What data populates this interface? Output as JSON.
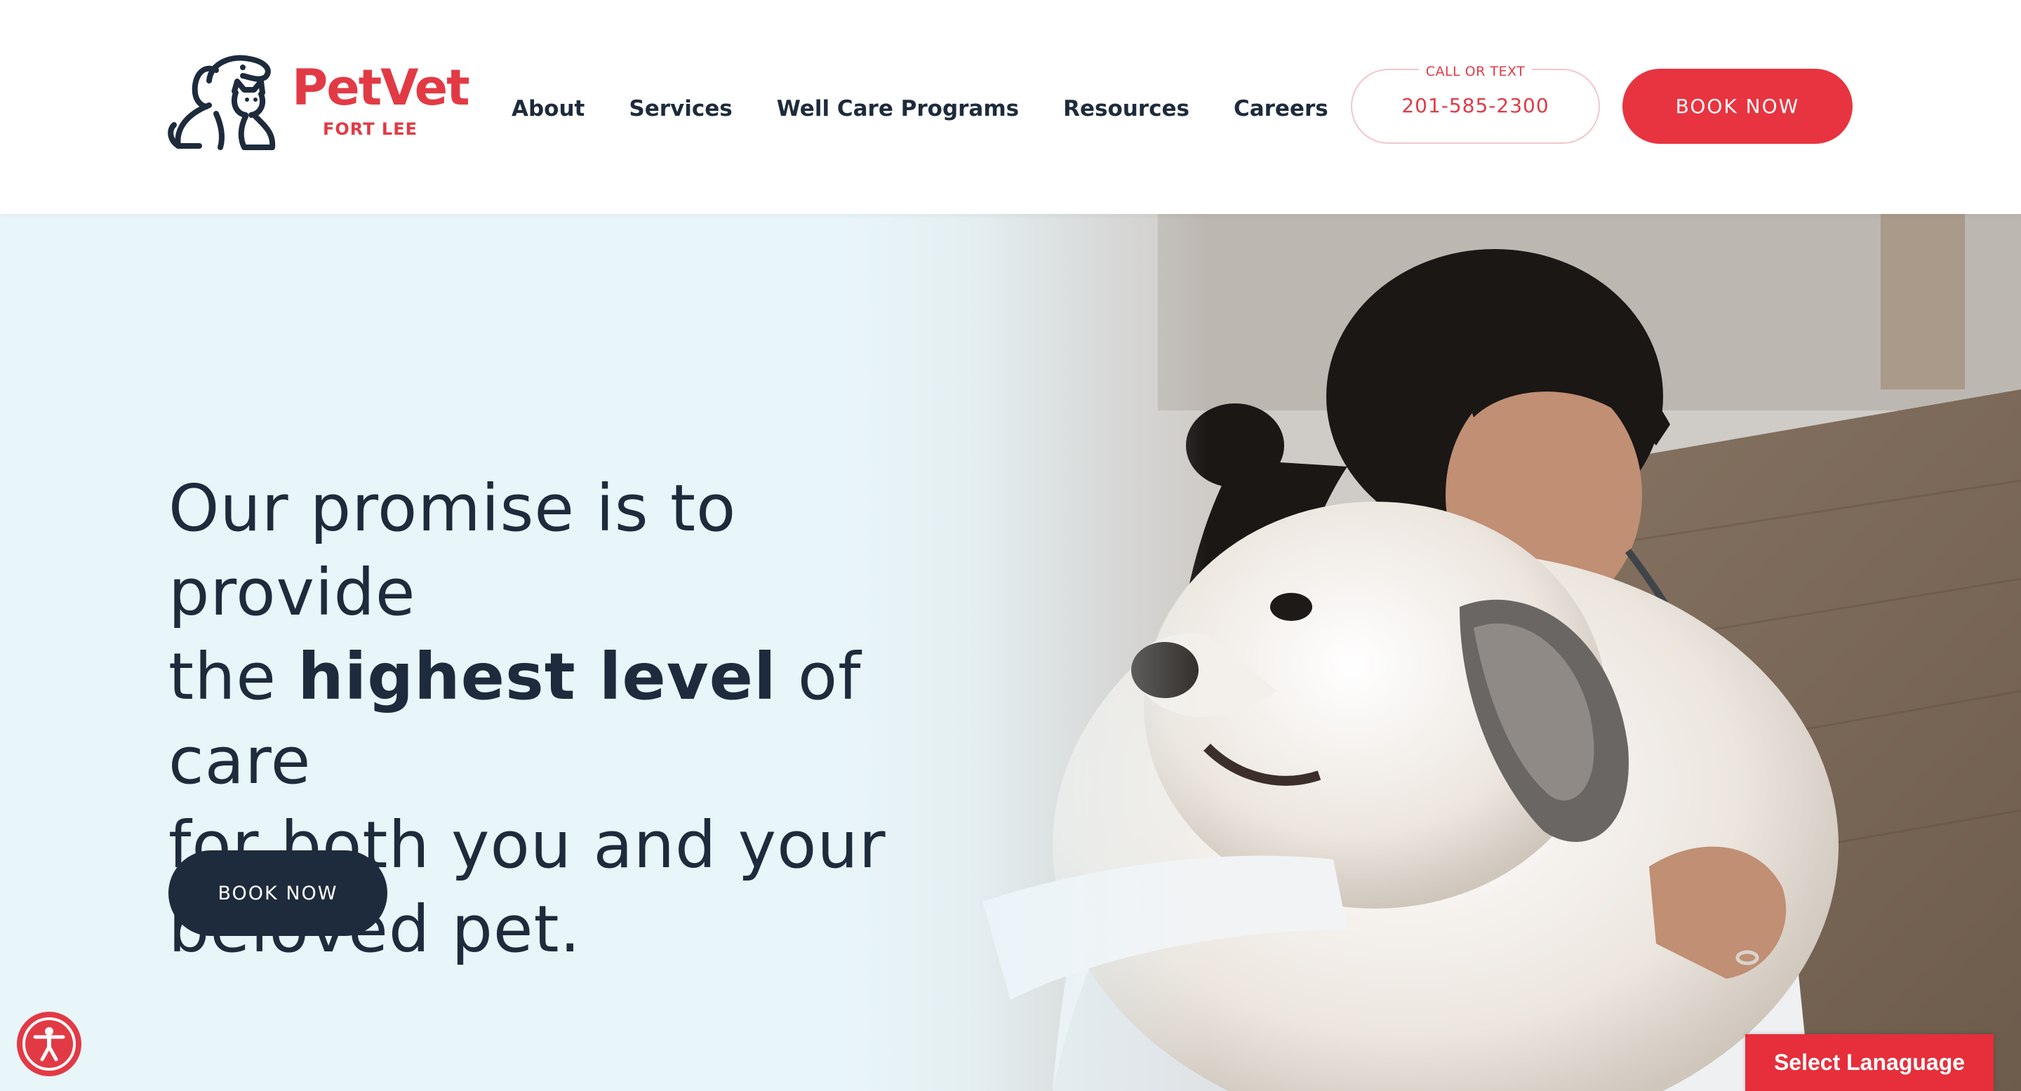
{
  "brand": {
    "name": "PetVet",
    "location": "FORT LEE",
    "color": "#e23a45"
  },
  "nav": {
    "items": [
      {
        "label": "About"
      },
      {
        "label": "Services"
      },
      {
        "label": "Well Care Programs"
      },
      {
        "label": "Resources"
      },
      {
        "label": "Careers"
      }
    ]
  },
  "contact": {
    "label": "CALL OR TEXT",
    "phone": "201-585-2300"
  },
  "header_cta": {
    "label": "BOOK NOW"
  },
  "hero": {
    "line1": "Our promise is to provide",
    "line2_pre": "the ",
    "line2_bold": "highest level",
    "line2_post": " of care",
    "line3": "for both you and your",
    "line4": "beloved pet.",
    "cta_label": "BOOK NOW",
    "background": "#e8f5f9"
  },
  "widgets": {
    "accessibility_icon": "accessibility-icon",
    "language_label": "Select Lanaguage"
  }
}
